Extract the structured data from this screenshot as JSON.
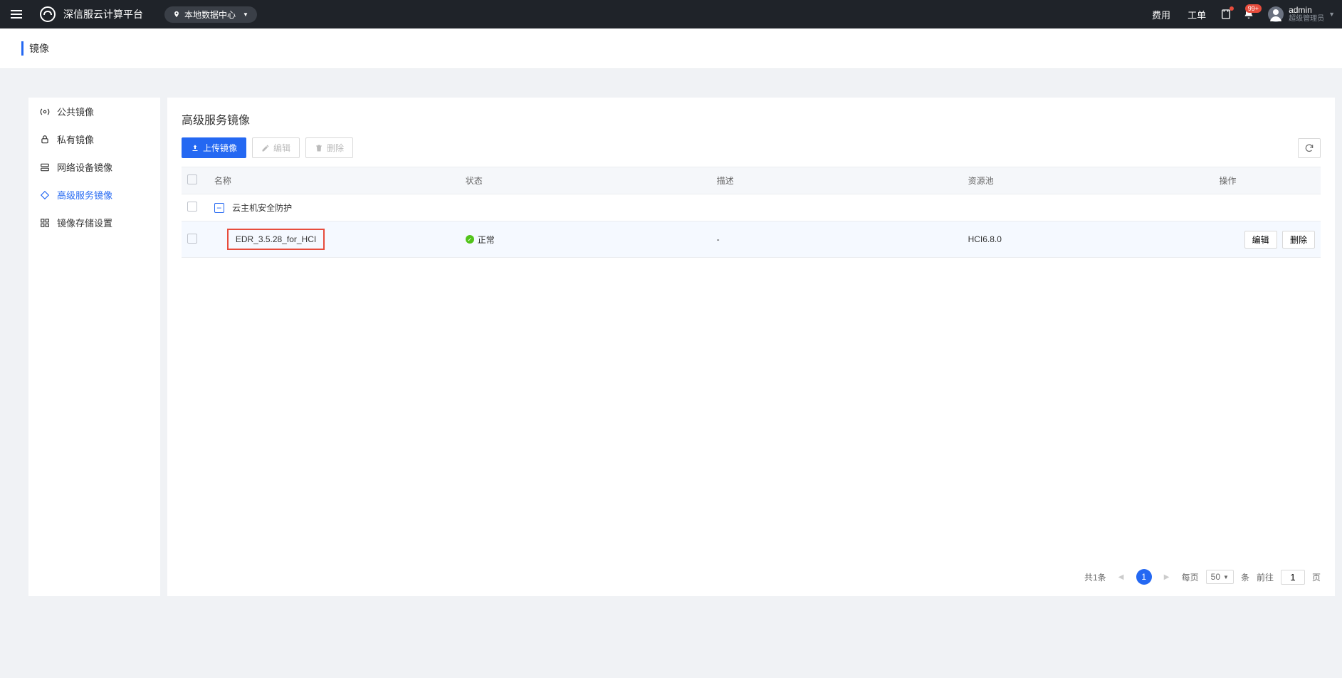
{
  "header": {
    "platform_name": "深信服云计算平台",
    "datacenter": "本地数据中心",
    "nav": {
      "fee": "费用",
      "ticket": "工单"
    },
    "notification_badge": "99+",
    "user": {
      "name": "admin",
      "role": "超级管理员"
    }
  },
  "tabs": {
    "active": "镜像"
  },
  "sidebar": {
    "items": [
      {
        "label": "公共镜像"
      },
      {
        "label": "私有镜像"
      },
      {
        "label": "网络设备镜像"
      },
      {
        "label": "高级服务镜像"
      },
      {
        "label": "镜像存储设置"
      }
    ]
  },
  "main": {
    "title": "高级服务镜像",
    "toolbar": {
      "upload": "上传镜像",
      "edit": "编辑",
      "delete": "删除"
    },
    "columns": {
      "name": "名称",
      "status": "状态",
      "desc": "描述",
      "pool": "资源池",
      "action": "操作"
    },
    "group": {
      "label": "云主机安全防护"
    },
    "row": {
      "name": "EDR_3.5.28_for_HCI",
      "status": "正常",
      "desc": "-",
      "pool": "HCI6.8.0",
      "edit": "编辑",
      "delete": "删除"
    }
  },
  "pagination": {
    "total_prefix": "共",
    "total_count": "1",
    "total_suffix": "条",
    "current": "1",
    "per_page_label": "每页",
    "per_page_value": "50",
    "per_page_suffix": "条",
    "goto_label": "前往",
    "goto_value": "1",
    "goto_suffix": "页"
  }
}
